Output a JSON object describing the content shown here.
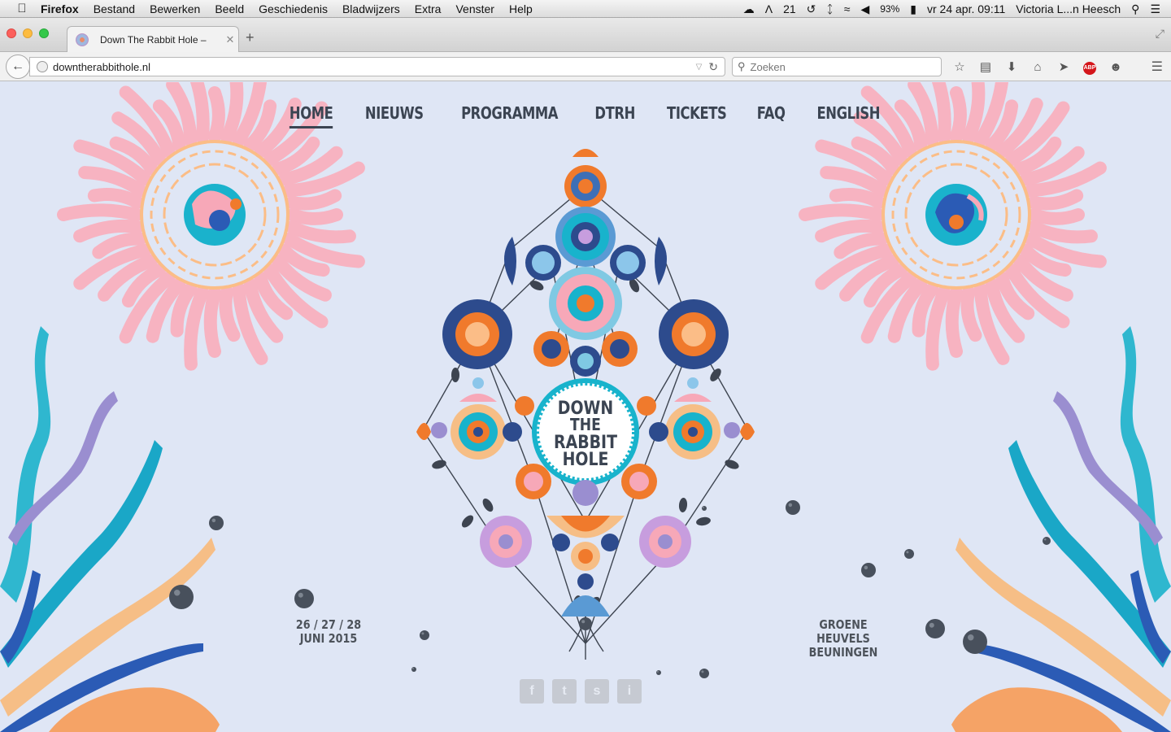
{
  "menubar": {
    "apple_icon": "apple-icon",
    "items": [
      "Firefox",
      "Bestand",
      "Bewerken",
      "Beeld",
      "Geschiedenis",
      "Bladwijzers",
      "Extra",
      "Venster",
      "Help"
    ],
    "notifications": "21",
    "battery": "93%",
    "clock": "vr 24 apr.  09:11",
    "user": "Victoria L...n Heesch"
  },
  "browser": {
    "tab_title": "Down The Rabbit Hole –",
    "new_tab": "+",
    "url": "downtherabbithole.nl",
    "search_placeholder": "Zoeken"
  },
  "site": {
    "nav": [
      "HOME",
      "NIEUWS",
      "PROGRAMMA",
      "DTRH",
      "TICKETS",
      "FAQ",
      "ENGLISH"
    ],
    "active_nav": "HOME",
    "logo_text": [
      "DOWN",
      "THE",
      "RABBIT",
      "HOLE"
    ],
    "dates": [
      "26 / 27 / 28",
      "JUNI 2015"
    ],
    "location": [
      "GROENE HEUVELS",
      "BEUNINGEN"
    ],
    "social": [
      "f",
      "t",
      "s",
      "i"
    ]
  },
  "colors": {
    "background": "#dfe6f5",
    "nav_text": "#3b4452",
    "orange": "#f07a2c",
    "teal": "#18b3cc",
    "pink": "#f7a8b8"
  }
}
